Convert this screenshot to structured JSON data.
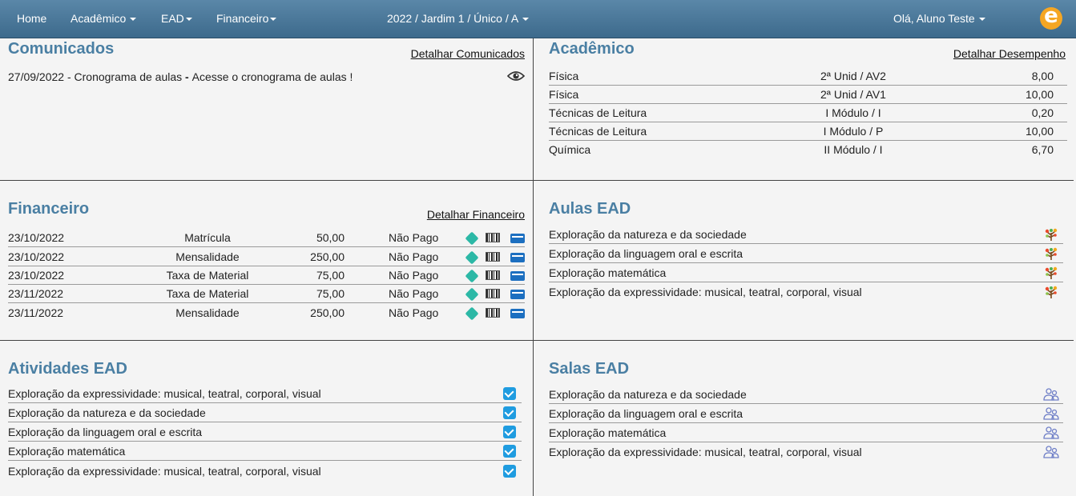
{
  "nav": {
    "home": "Home",
    "academico": "Acadêmico",
    "ead": "EAD",
    "financeiro": "Financeiro",
    "context": "2022 / Jardim 1 / Único / A",
    "user": "Olá, Aluno Teste",
    "logo_letter": "e"
  },
  "comunicados": {
    "title": "Comunicados",
    "link": "Detalhar Comunicados",
    "items": [
      {
        "date_title": "27/09/2022 - Cronograma de aulas",
        "sep": " - ",
        "text": "Acesse o cronograma de aulas !"
      }
    ]
  },
  "academico": {
    "title": "Acadêmico",
    "link": "Detalhar Desempenho",
    "rows": [
      {
        "subject": "Física",
        "unit": "2ª Unid / AV2",
        "grade": "8,00"
      },
      {
        "subject": "Física",
        "unit": "2ª Unid / AV1",
        "grade": "10,00"
      },
      {
        "subject": "Técnicas de Leitura",
        "unit": "I Módulo / I",
        "grade": "0,20"
      },
      {
        "subject": "Técnicas de Leitura",
        "unit": "I Módulo / P",
        "grade": "10,00"
      },
      {
        "subject": "Química",
        "unit": "II Módulo / I",
        "grade": "6,70"
      }
    ]
  },
  "financeiro": {
    "title": "Financeiro",
    "link": "Detalhar Financeiro",
    "rows": [
      {
        "date": "23/10/2022",
        "desc": "Matrícula",
        "value": "50,00",
        "status": "Não Pago"
      },
      {
        "date": "23/10/2022",
        "desc": "Mensalidade",
        "value": "250,00",
        "status": "Não Pago"
      },
      {
        "date": "23/10/2022",
        "desc": "Taxa de Material",
        "value": "75,00",
        "status": "Não Pago"
      },
      {
        "date": "23/11/2022",
        "desc": "Taxa de Material",
        "value": "75,00",
        "status": "Não Pago"
      },
      {
        "date": "23/11/2022",
        "desc": "Mensalidade",
        "value": "250,00",
        "status": "Não Pago"
      }
    ]
  },
  "aulas_ead": {
    "title": "Aulas EAD",
    "items": [
      "Exploração da natureza e da sociedade",
      "Exploração da linguagem oral e escrita",
      "Exploração matemática",
      "Exploração da expressividade: musical, teatral, corporal, visual"
    ]
  },
  "atividades_ead": {
    "title": "Atividades EAD",
    "items": [
      "Exploração da expressividade: musical, teatral, corporal, visual",
      "Exploração da natureza e da sociedade",
      "Exploração da linguagem oral e escrita",
      "Exploração matemática",
      "Exploração da expressividade: musical, teatral, corporal, visual"
    ]
  },
  "salas_ead": {
    "title": "Salas EAD",
    "items": [
      "Exploração da natureza e da sociedade",
      "Exploração da linguagem oral e escrita",
      "Exploração matemática",
      "Exploração da expressividade: musical, teatral, corporal, visual"
    ]
  },
  "colors": {
    "navbar": "#4a7799",
    "title": "#4a7fa3",
    "pix": "#2cb8a6",
    "card": "#1c6fc0",
    "check": "#1f9ce0",
    "logo": "#f5a623"
  }
}
